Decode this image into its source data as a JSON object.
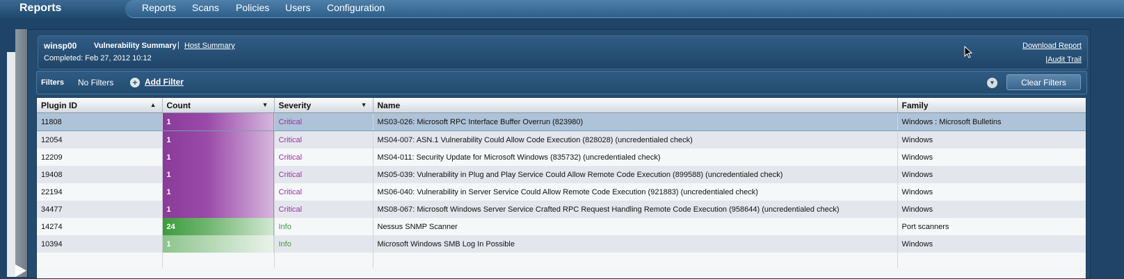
{
  "app": {
    "title": "Reports"
  },
  "nav": {
    "items": [
      "Reports",
      "Scans",
      "Policies",
      "Users",
      "Configuration"
    ]
  },
  "report": {
    "host": "winsp00",
    "view": "Vulnerability Summary",
    "separator": "|",
    "host_summary_link": "Host Summary",
    "completed": "Completed: Feb 27, 2012 10:12",
    "download_link": "Download Report",
    "audit_prefix": "|",
    "audit_link": "Audit Trail"
  },
  "filters": {
    "label": "Filters",
    "status": "No Filters",
    "add_label": "Add Filter",
    "clear_label": "Clear Filters"
  },
  "table": {
    "columns": [
      {
        "label": "Plugin ID",
        "sort": "▲"
      },
      {
        "label": "Count",
        "sort": "▼"
      },
      {
        "label": "Severity",
        "sort": "▼"
      },
      {
        "label": "Name",
        "sort": ""
      },
      {
        "label": "Family",
        "sort": ""
      }
    ],
    "rows": [
      {
        "plugin_id": "11808",
        "count": "1",
        "severity": "Critical",
        "name": "MS03-026: Microsoft RPC Interface Buffer Overrun (823980)",
        "family": "Windows : Microsoft Bulletins"
      },
      {
        "plugin_id": "12054",
        "count": "1",
        "severity": "Critical",
        "name": "MS04-007: ASN.1 Vulnerability Could Allow Code Execution (828028) (uncredentialed check)",
        "family": "Windows"
      },
      {
        "plugin_id": "12209",
        "count": "1",
        "severity": "Critical",
        "name": "MS04-011: Security Update for Microsoft Windows (835732) (uncredentialed check)",
        "family": "Windows"
      },
      {
        "plugin_id": "19408",
        "count": "1",
        "severity": "Critical",
        "name": "MS05-039: Vulnerability in Plug and Play Service Could Allow Remote Code Execution (899588) (uncredentialed check)",
        "family": "Windows"
      },
      {
        "plugin_id": "22194",
        "count": "1",
        "severity": "Critical",
        "name": "MS06-040: Vulnerability in Server Service Could Allow Remote Code Execution (921883) (uncredentialed check)",
        "family": "Windows"
      },
      {
        "plugin_id": "34477",
        "count": "1",
        "severity": "Critical",
        "name": "MS08-067: Microsoft Windows Server Service Crafted RPC Request Handling Remote Code Execution (958644) (uncredentialed check)",
        "family": "Windows"
      },
      {
        "plugin_id": "14274",
        "count": "24",
        "severity": "Info",
        "name": "Nessus SNMP Scanner",
        "family": "Port scanners"
      },
      {
        "plugin_id": "10394",
        "count": "1",
        "severity": "Info",
        "name": "Microsoft Windows SMB Log In Possible",
        "family": "Windows"
      }
    ]
  },
  "colors": {
    "critical": "#9b2fa6",
    "info": "#3c9a3c",
    "panel": "#244a6e",
    "selected_row": "#aec3d8"
  },
  "icons": {
    "add_filter": "plus-circle-icon",
    "options": "chevron-down-icon",
    "mouse": "mouse-cursor-icon"
  }
}
